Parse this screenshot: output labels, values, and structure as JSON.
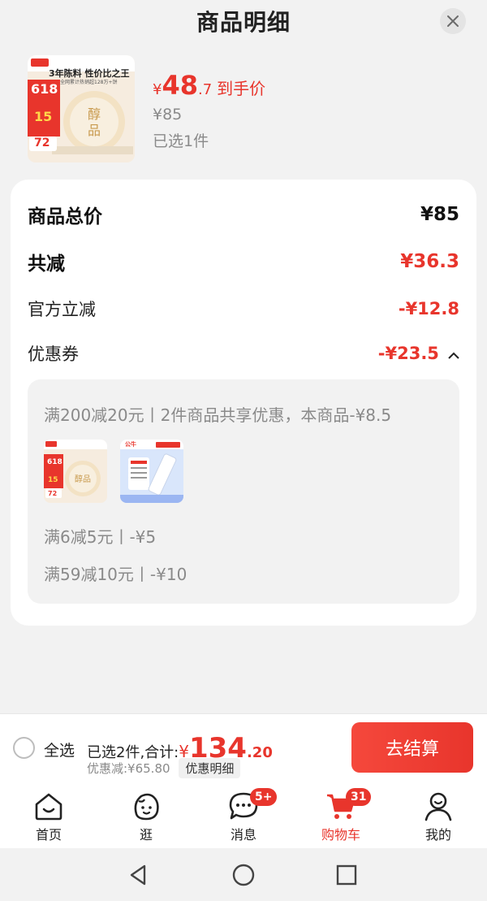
{
  "sheet": {
    "title": "商品明细"
  },
  "product": {
    "image_label": "3年陈料 性价比之王",
    "image_sub": "全网累计热销超128万+饼",
    "image_badge": "618",
    "image_discount": "15",
    "image_price": "72",
    "price_symbol": "¥",
    "price_int": "48",
    "price_dec": ".7",
    "price_tag": "到手价",
    "original_price": "¥85",
    "selected": "已选1件"
  },
  "summary": {
    "total_label": "商品总价",
    "total_value": "¥85",
    "reduce_label": "共减",
    "reduce_value": "¥36.3",
    "official_label": "官方立减",
    "official_value": "-¥12.8",
    "coupon_label": "优惠券",
    "coupon_value": "-¥23.5"
  },
  "coupons": {
    "line1": "满200减20元丨2件商品共享优惠，本商品-¥8.5",
    "line2": "满6减5元丨-¥5",
    "line3": "满59减10元丨-¥10",
    "thumb2_brand": "公牛"
  },
  "bottom": {
    "select_all": "全选",
    "total_prefix": "已选2件,合计:",
    "total_symbol": "¥",
    "total_int": "134",
    "total_dec": ".20",
    "discount_text": "优惠减:¥65.80",
    "detail_chip": "优惠明细",
    "checkout": "去结算"
  },
  "tabs": [
    {
      "label": "首页",
      "icon": "home-icon"
    },
    {
      "label": "逛",
      "icon": "stroll-icon"
    },
    {
      "label": "消息",
      "icon": "message-icon",
      "badge": "5+"
    },
    {
      "label": "购物车",
      "icon": "cart-icon",
      "badge": "31",
      "active": true
    },
    {
      "label": "我的",
      "icon": "profile-icon"
    }
  ],
  "colors": {
    "accent": "#e8352c",
    "muted": "#8a8a8a",
    "background": "#f2f2f2"
  }
}
